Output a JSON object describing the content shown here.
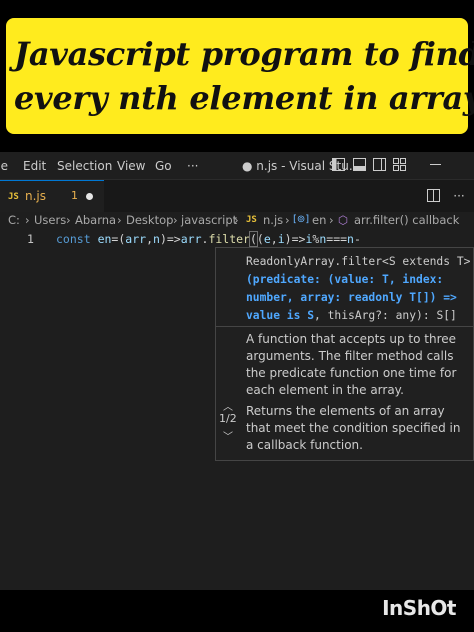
{
  "banner": {
    "line1": "Javascript program to find",
    "line2": "every nth element in array"
  },
  "menubar": {
    "items": [
      "lle",
      "Edit",
      "Selection",
      "View",
      "Go",
      "···"
    ],
    "window_title": "● n.js - Visual Stu..."
  },
  "tab": {
    "badge": "JS",
    "name": "n.js",
    "count": "1"
  },
  "breadcrumb": {
    "items": [
      "C:",
      "Users",
      "Abarna",
      "Desktop",
      "javascript",
      "n.js",
      "en",
      "arr.filter() callback"
    ],
    "separator": "›",
    "var_badge": "[⊚]",
    "cube": "⬡"
  },
  "code": {
    "line_number": "1",
    "kw": "const",
    "v1": "en",
    "t1": "=(",
    "v2": "arr",
    "t2": ",",
    "v3": "n",
    "t3": ")=>",
    "v4": "arr",
    "t4": ".",
    "fn": "filter",
    "t5": "(",
    "t6": "(",
    "v5": "e",
    "t7": ",",
    "v6": "i",
    "t8": ")=>",
    "v7": "i",
    "t9": "%",
    "v8": "n",
    "t10": "===",
    "v9": "n",
    "t11": "-"
  },
  "hover": {
    "sig_line1": "ReadonlyArray.filter<S extends T>",
    "sig_line2": "(predicate: (value: T, index:",
    "sig_line3": "number, array: readonly T[]) =>",
    "sig_line4a": "value is S",
    "sig_line4b": ", thisArg?: any): S[]",
    "doc1": "A function that accepts up to three arguments. The filter method calls the predicate function one time for each element in the array.",
    "doc2": "Returns the elements of an array that meet the condition specified in a callback function.",
    "pager": "1/2",
    "up": "︿",
    "down": "﹀"
  },
  "watermark": "InShOt"
}
